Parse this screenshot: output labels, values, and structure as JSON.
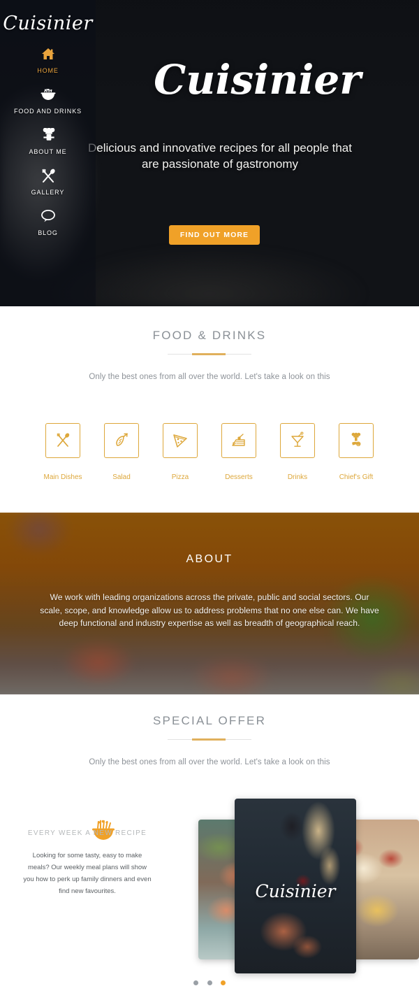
{
  "brand": "Cuisinier",
  "sidebar": {
    "logo": "Cuisinier",
    "items": [
      {
        "label": "HOME",
        "icon": "home-icon",
        "active": true
      },
      {
        "label": "FOOD AND DRINKS",
        "icon": "food-bowl-icon",
        "active": false
      },
      {
        "label": "ABOUT ME",
        "icon": "chef-icon",
        "active": false
      },
      {
        "label": "GALLERY",
        "icon": "fork-spoon-icon",
        "active": false
      },
      {
        "label": "BLOG",
        "icon": "speech-bubble-icon",
        "active": false
      }
    ]
  },
  "hero": {
    "title": "Cuisinier",
    "subtitle": "Delicious and innovative recipes for all people that are passionate of gastronomy",
    "cta_label": "FIND OUT MORE",
    "cta_color": "#f0a128"
  },
  "food": {
    "heading": "FOOD & DRINKS",
    "subheading": "Only the best ones from all over the world. Let's take a look on this",
    "accent_color": "#dda73a",
    "categories": [
      {
        "label": "Main Dishes",
        "icon": "fork-spoon-crossed-icon"
      },
      {
        "label": "Salad",
        "icon": "carrot-icon"
      },
      {
        "label": "Pizza",
        "icon": "pizza-slice-icon"
      },
      {
        "label": "Desserts",
        "icon": "cake-slice-icon"
      },
      {
        "label": "Drinks",
        "icon": "cocktail-glass-icon"
      },
      {
        "label": "Chief's Gift",
        "icon": "chef-hand-icon"
      }
    ]
  },
  "about": {
    "heading": "ABOUT",
    "text": "We work with leading organizations across the private, public and social sectors. Our scale, scope, and knowledge allow us to address problems that no one else can. We have deep functional and industry expertise as well as breadth of geographical reach."
  },
  "offer": {
    "heading": "SPECIAL OFFER",
    "subheading": "Only the best ones from all over the world. Let's take a look on this",
    "promo": {
      "title": "EVERY WEEK A NEW RECIPE",
      "icon": "noodle-bowl-icon",
      "text": "Looking for some tasty, easy to make meals? Our weekly meal plans will show you how to perk up family dinners and even find new favourites."
    },
    "carousel": {
      "center_caption": "Cuisinier",
      "dots": [
        {
          "active": false
        },
        {
          "active": false
        },
        {
          "active": true
        }
      ],
      "active_dot_color": "#f0a128",
      "inactive_dot_color": "#9aa0a6"
    }
  }
}
